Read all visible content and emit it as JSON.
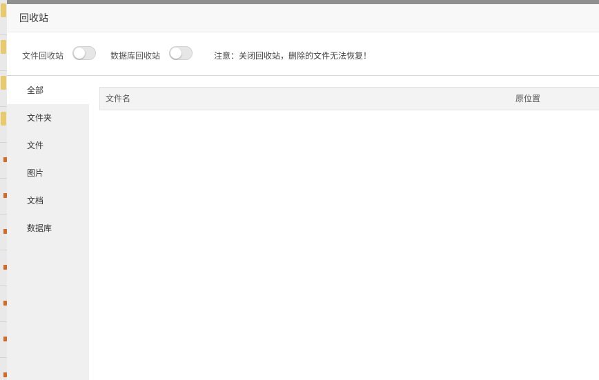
{
  "dialog": {
    "title": "回收站"
  },
  "toolbar": {
    "file_recycle_label": "文件回收站",
    "file_recycle_enabled": false,
    "db_recycle_label": "数据库回收站",
    "db_recycle_enabled": false,
    "notice": "注意：关闭回收站，删除的文件无法恢复！"
  },
  "sidebar": {
    "items": [
      {
        "label": "全部",
        "active": true
      },
      {
        "label": "文件夹",
        "active": false
      },
      {
        "label": "文件",
        "active": false
      },
      {
        "label": "图片",
        "active": false
      },
      {
        "label": "文档",
        "active": false
      },
      {
        "label": "数据库",
        "active": false
      }
    ]
  },
  "table": {
    "columns": [
      "文件名",
      "原位置"
    ],
    "rows": []
  },
  "colors": {
    "overlay": "#8f8f8f",
    "sidebar_bg": "#f0f0f0",
    "switch_off": "#e6e6e6",
    "folder_icon": "#e8c96b"
  }
}
